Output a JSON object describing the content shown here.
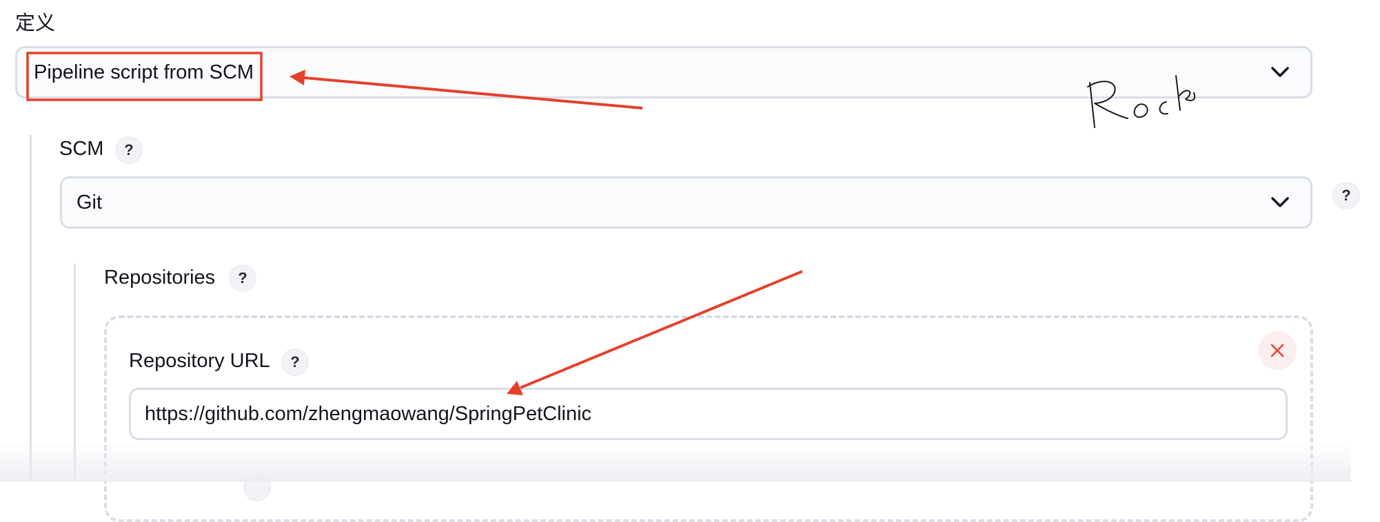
{
  "definition": {
    "label": "定义",
    "selected": "Pipeline script from SCM"
  },
  "scm": {
    "label": "SCM",
    "help": "?",
    "selected": "Git",
    "side_help": "?"
  },
  "repositories": {
    "label": "Repositories",
    "help": "?",
    "repository_url": {
      "label": "Repository URL",
      "help": "?",
      "value": "https://github.com/zhengmaowang/SpringPetClinic"
    }
  },
  "annotations": {
    "highlight_color": "#e5402b",
    "signature": "Rock"
  },
  "icons": [
    "chevron-down-icon",
    "help-icon",
    "close-icon"
  ]
}
